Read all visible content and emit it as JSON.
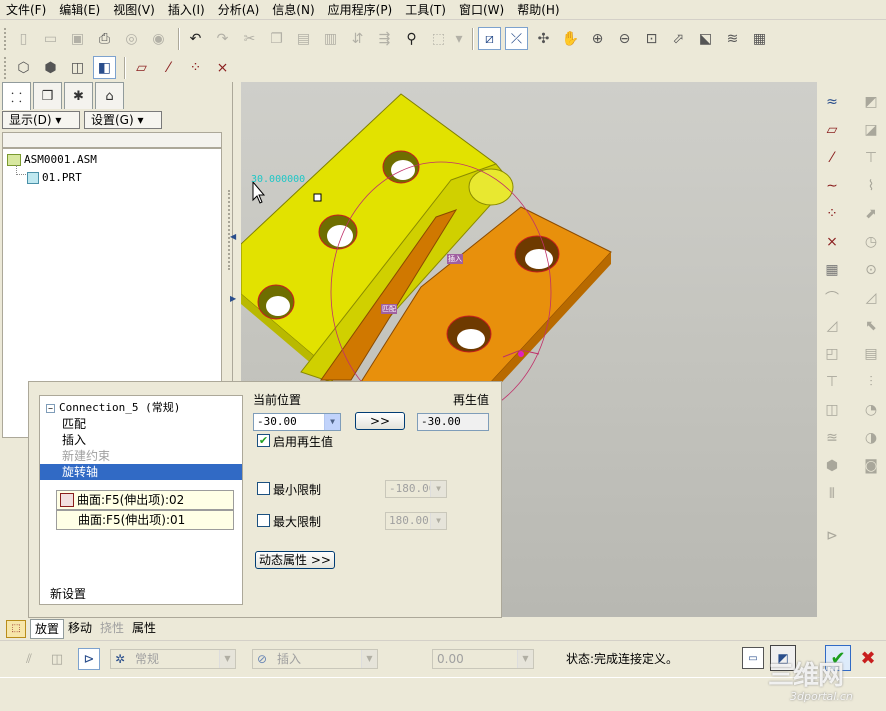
{
  "menu": [
    "文件(F)",
    "编辑(E)",
    "视图(V)",
    "插入(I)",
    "分析(A)",
    "信息(N)",
    "应用程序(P)",
    "工具(T)",
    "窗口(W)",
    "帮助(H)"
  ],
  "left_panel": {
    "display_button": "显示(D) ▾",
    "settings_button": "设置(G) ▾",
    "tree": [
      {
        "label": "ASM0001.ASM"
      },
      {
        "label": "01.PRT"
      }
    ]
  },
  "viewport": {
    "readout": "30.000000",
    "tag_insert": "插入",
    "tag_match": "匹配"
  },
  "placement": {
    "connection_title": "Connection_5 (常规)",
    "constraints": [
      "匹配",
      "插入",
      "新建约束",
      "旋转轴"
    ],
    "selected_constraint": "旋转轴",
    "references": [
      "曲面:F5(伸出项):02",
      "曲面:F5(伸出项):01"
    ],
    "new_set": "新设置",
    "current_position_label": "当前位置",
    "current_position_value": "-30.00",
    "regen_label": "再生值",
    "regen_value": "-30.00",
    "arrow_button": ">>",
    "enable_regen_label": "启用再生值",
    "enable_regen_checked": true,
    "min_limit_label": "最小限制",
    "min_limit_value": "-180.00",
    "max_limit_label": "最大限制",
    "max_limit_value": "180.00",
    "dynamic_props_button": "动态属性 >>"
  },
  "dashboard": {
    "tabs": [
      "放置",
      "移动",
      "挠性",
      "属性"
    ],
    "selected_tab": "放置",
    "disabled_tabs": [
      "挠性"
    ],
    "connection_type": "常规",
    "constraint_type": "插入",
    "offset_value": "0.00",
    "status_text": "状态:完成连接定义。"
  },
  "watermark": {
    "big": "三维网",
    "small": "3dportal.cn"
  },
  "colors": {
    "yellow_part": "#E2E200",
    "orange_part": "#E8900C",
    "edge_red": "#C81E1E",
    "selection": "#316AC5"
  }
}
